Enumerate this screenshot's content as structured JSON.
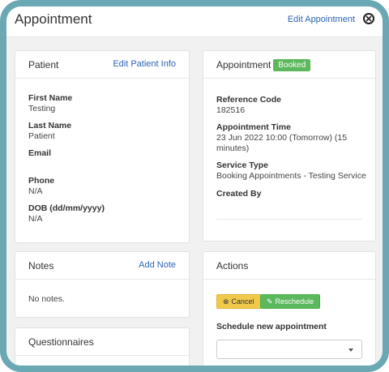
{
  "header": {
    "title": "Appointment",
    "edit_link": "Edit Appointment"
  },
  "patient": {
    "title": "Patient",
    "edit_link": "Edit Patient Info",
    "fields": [
      {
        "label": "First Name",
        "value": "Testing"
      },
      {
        "label": "Last Name",
        "value": "Patient"
      },
      {
        "label": "Email",
        "value": ""
      },
      {
        "label": "Phone",
        "value": "N/A"
      },
      {
        "label": "DOB (dd/mm/yyyy)",
        "value": "N/A"
      }
    ]
  },
  "appointment": {
    "title": "Appointment",
    "status": "Booked",
    "status_color": "#5cb85c",
    "fields": [
      {
        "label": "Reference Code",
        "value": "182516"
      },
      {
        "label": "Appointment Time",
        "value": "23 Jun 2022 10:00 (Tomorrow) (15 minutes)"
      },
      {
        "label": "Service Type",
        "value": "Booking Appointments - Testing Service"
      },
      {
        "label": "Created By",
        "value": ""
      }
    ]
  },
  "notes": {
    "title": "Notes",
    "add_link": "Add Note",
    "empty_text": "No notes."
  },
  "actions": {
    "title": "Actions",
    "cancel_label": "Cancel",
    "reschedule_label": "Reschedule",
    "schedule_label": "Schedule new appointment",
    "select_value": ""
  },
  "questionnaires": {
    "title": "Questionnaires"
  },
  "colors": {
    "frame": "#6aa9b3",
    "link": "#2c64b5",
    "cancel": "#f0c94b",
    "reschedule": "#5cb85c"
  }
}
